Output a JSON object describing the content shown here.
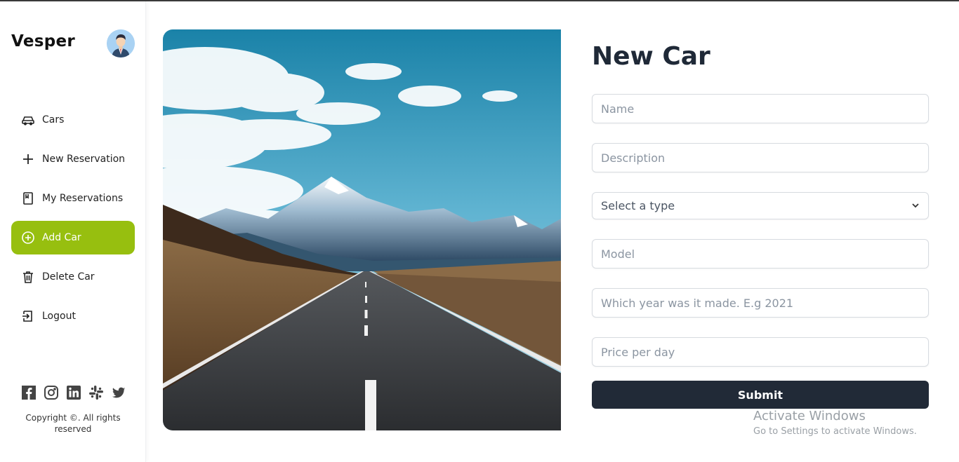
{
  "brand": "Vesper",
  "nav": {
    "cars": "Cars",
    "new_reservation": "New Reservation",
    "my_reservations": "My Reservations",
    "add_car": "Add Car",
    "delete_car": "Delete Car",
    "logout": "Logout"
  },
  "copyright": "Copyright ©. All rights reserved",
  "form": {
    "title": "New Car",
    "name_placeholder": "Name",
    "description_placeholder": "Description",
    "type_select": "Select a type",
    "model_placeholder": "Model",
    "year_placeholder": "Which year was it made. E.g 2021",
    "price_placeholder": "Price per day",
    "submit": "Submit"
  },
  "watermark": {
    "line1": "Activate Windows",
    "line2": "Go to Settings to activate Windows."
  },
  "colors": {
    "accent": "#97bf0f",
    "submit_bg": "#212a37"
  }
}
